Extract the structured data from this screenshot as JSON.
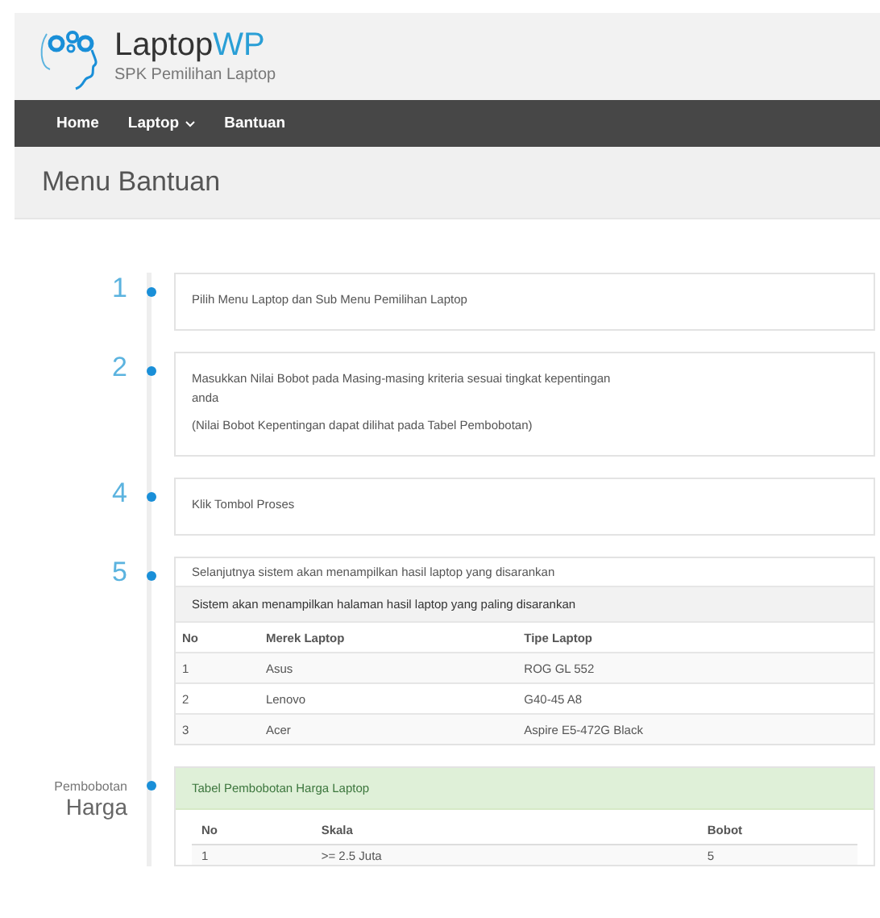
{
  "logo": {
    "name": "Laptop",
    "accent": "WP",
    "tagline": "SPK Pemilihan Laptop"
  },
  "nav": [
    {
      "label": "Home",
      "dropdown": false
    },
    {
      "label": "Laptop",
      "dropdown": true
    },
    {
      "label": "Bantuan",
      "dropdown": false
    }
  ],
  "page_title": "Menu Bantuan",
  "steps": [
    {
      "kind": "text",
      "number": "1",
      "lines": [
        "Pilih Menu Laptop dan Sub Menu Pemilihan Laptop"
      ]
    },
    {
      "kind": "text",
      "number": "2",
      "lines": [
        "Masukkan Nilai Bobot pada Masing-masing kriteria sesuai tingkat kepentingan anda",
        "(Nilai Bobot Kepentingan dapat dilihat pada Tabel Pembobotan)"
      ]
    },
    {
      "kind": "text",
      "number": "4",
      "lines": [
        "Klik Tombol Proses"
      ]
    },
    {
      "kind": "table",
      "number": "5",
      "lines": [
        "Selanjutnya sistem akan menampilkan hasil laptop yang disarankan"
      ],
      "heading": "Sistem akan menampilkan halaman hasil laptop yang paling disarankan",
      "columns": [
        "No",
        "Merek Laptop",
        "Tipe Laptop"
      ],
      "rows": [
        [
          "1",
          "Asus",
          "ROG GL 552"
        ],
        [
          "2",
          "Lenovo",
          "G40-45 A8"
        ],
        [
          "3",
          "Acer",
          "Aspire E5-472G Black"
        ]
      ]
    },
    {
      "kind": "weight_table",
      "label_small": "Pembobotan",
      "label_big": "Harga",
      "heading": "Tabel Pembobotan Harga Laptop",
      "columns": [
        "No",
        "Skala",
        "Bobot"
      ],
      "rows": [
        [
          "1",
          ">= 2.5 Juta",
          "5"
        ]
      ]
    }
  ]
}
